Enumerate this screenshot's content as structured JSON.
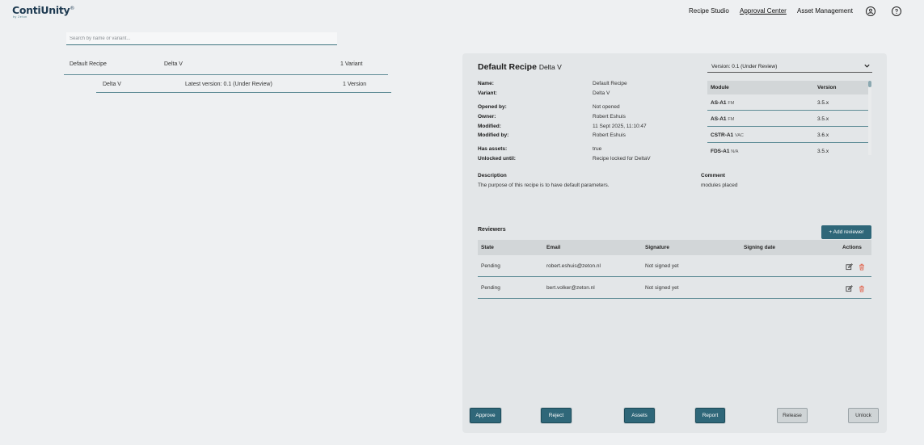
{
  "app": {
    "logo": "ContiUnity",
    "logo_mark": "®",
    "logo_sub": "by Zeton"
  },
  "nav": {
    "recipe_studio": "Recipe Studio",
    "approval_center": "Approval Center",
    "asset_management": "Asset Management",
    "account_icon": "user-circle-icon",
    "help_icon": "help-icon"
  },
  "search": {
    "placeholder": "Search by name or variant..."
  },
  "tree": {
    "recipe": {
      "name": "Default Recipe",
      "platform": "Delta V",
      "count": "1 Variant"
    },
    "variant": {
      "name": "Delta V",
      "latest": "Latest version: 0.1 (Under Review)",
      "count": "1 Version"
    }
  },
  "detail": {
    "title": "Default Recipe",
    "subtitle": "Delta V",
    "version_select": "Version: 0.1 (Under Review)",
    "fields": {
      "name_label": "Name:",
      "name_value": "Default Recipe",
      "variant_label": "Variant:",
      "variant_value": "Delta V",
      "opened_label": "Opened by:",
      "opened_value": "Not opened",
      "owner_label": "Owner:",
      "owner_value": "Robert Eshuis",
      "modified_label": "Modified:",
      "modified_value": "11 Sept 2025, 11:10:47",
      "modified_by_label": "Modified by:",
      "modified_by_value": "Robert Eshuis",
      "assets_label": "Has assets:",
      "assets_value": "true",
      "unlocked_label": "Unlocked until:",
      "unlocked_value": "Recipe locked for DeltaV"
    },
    "modules": {
      "header_module": "Module",
      "header_version": "Version",
      "rows": [
        {
          "name": "AS-A1",
          "type": "FM",
          "version": "3.5.x"
        },
        {
          "name": "AS-A1",
          "type": "FM",
          "version": "3.5.x"
        },
        {
          "name": "CSTR-A1",
          "type": "VAC",
          "version": "3.6.x"
        },
        {
          "name": "FDS-A1",
          "type": "N/A",
          "version": "3.5.x"
        }
      ]
    },
    "description_label": "Description",
    "description_value": "The purpose of this recipe is to have default parameters.",
    "comment_label": "Comment",
    "comment_value": "modules placed"
  },
  "reviewers": {
    "title": "Reviewers",
    "add_button": "+ Add reviewer",
    "columns": {
      "state": "State",
      "email": "Email",
      "signature": "Signature",
      "signing_date": "Signing date",
      "actions": "Actions"
    },
    "rows": [
      {
        "state": "Pending",
        "email": "robert.eshuis@zeton.nl",
        "signature": "Not signed yet",
        "signing_date": ""
      },
      {
        "state": "Pending",
        "email": "bert.volker@zeton.nl",
        "signature": "Not signed yet",
        "signing_date": ""
      }
    ]
  },
  "actions": {
    "approve": "Approve",
    "reject": "Reject",
    "assets": "Assets",
    "report": "Report",
    "release": "Release",
    "unlock": "Unlock"
  },
  "colors": {
    "primary": "#2f6779",
    "accent_line": "#5e8c96",
    "delete": "#e0573e",
    "background": "#eef0f2",
    "panel": "#e3e6e8"
  }
}
